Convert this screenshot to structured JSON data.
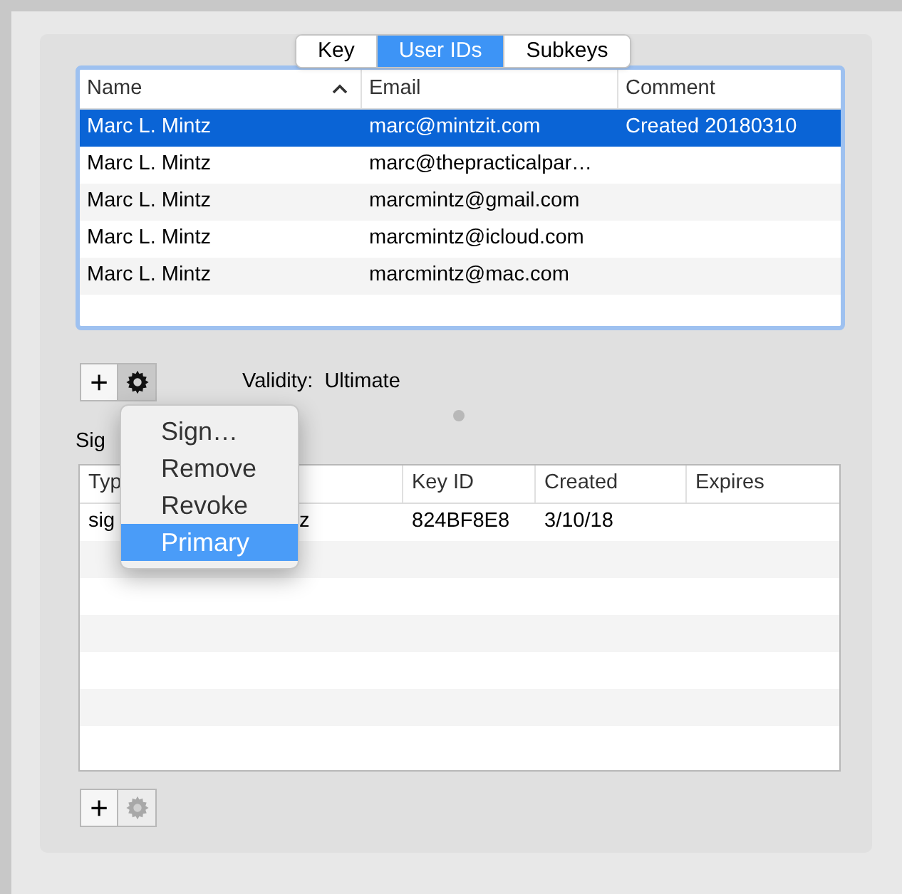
{
  "tabs": [
    {
      "label": "Key",
      "selected": false
    },
    {
      "label": "User IDs",
      "selected": true
    },
    {
      "label": "Subkeys",
      "selected": false
    }
  ],
  "user_ids": {
    "columns": [
      {
        "label": "Name",
        "sorted": true
      },
      {
        "label": "Email",
        "sorted": false
      },
      {
        "label": "Comment",
        "sorted": false
      }
    ],
    "rows": [
      {
        "name": "Marc L. Mintz",
        "email": "marc@mintzit.com",
        "comment": "Created 20180310",
        "selected": true
      },
      {
        "name": "Marc L. Mintz",
        "email": "marc@thepracticalpar…",
        "selected": false
      },
      {
        "name": "Marc L. Mintz",
        "email": "marcmintz@gmail.com",
        "selected": false
      },
      {
        "name": "Marc L. Mintz",
        "email": "marcmintz@icloud.com",
        "selected": false
      },
      {
        "name": "Marc L. Mintz",
        "email": "marcmintz@mac.com",
        "selected": false
      }
    ]
  },
  "user_id_buttons": {
    "add": "+",
    "action_disabled": false
  },
  "validity": {
    "label": "Validity:",
    "value": "Ultimate"
  },
  "signatures_label": "Sig",
  "signatures": {
    "columns": {
      "column_1": "Typ",
      "key_id": "Key ID",
      "created": "Created",
      "expires": "Expires"
    },
    "rows": [
      {
        "column_1": "sig",
        "column_2": "z",
        "key_id": "824BF8E8",
        "created": "3/10/18"
      }
    ]
  },
  "signature_buttons": {
    "add": "+",
    "action_disabled": true
  },
  "menu": {
    "items": [
      {
        "label": "Sign…",
        "selected": false
      },
      {
        "label": "Remove",
        "selected": false
      },
      {
        "label": "Revoke",
        "selected": false
      },
      {
        "label": "Primary",
        "selected": true
      }
    ]
  }
}
